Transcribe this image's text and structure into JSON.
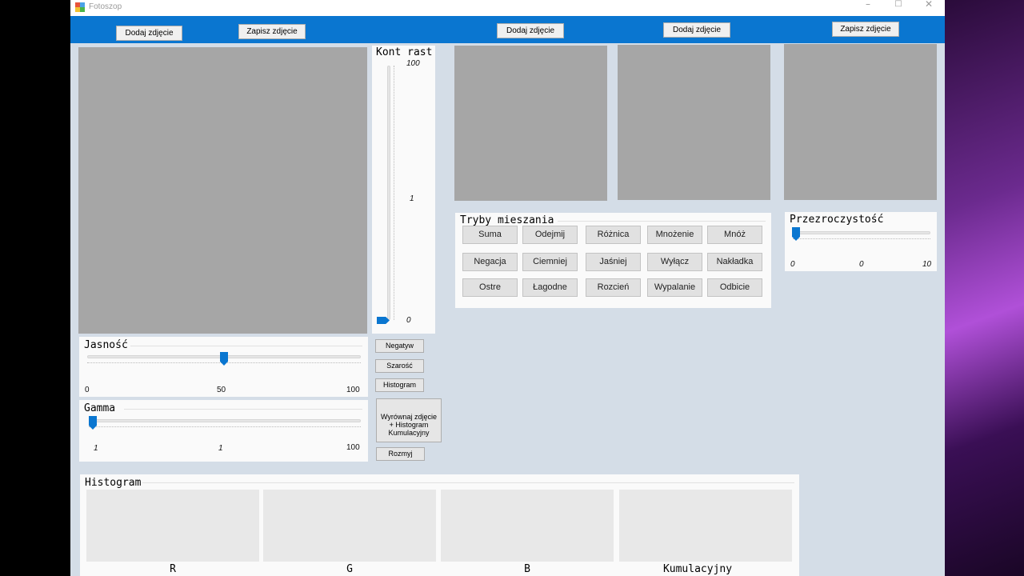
{
  "window": {
    "title": "Fotoszop",
    "controls": {
      "minimize": "–",
      "maximize": "□",
      "close": "✕"
    }
  },
  "toolbar": {
    "left_add": "Dodaj zdjęcie",
    "left_save": "Zapisz zdjęcie",
    "blend_add_1": "Dodaj zdjęcie",
    "blend_add_2": "Dodaj zdjęcie",
    "blend_save": "Zapisz zdjęcie"
  },
  "contrast": {
    "title": "Kont rast",
    "max_label": "100",
    "mid_label": "1",
    "min_label": "0",
    "value": 0
  },
  "brightness": {
    "title": "Jasność",
    "min_label": "0",
    "mid_label": "50",
    "max_label": "100",
    "value": 50
  },
  "gamma": {
    "title": "Gamma",
    "min_label": "1",
    "mid_label": "1",
    "max_label": "100",
    "value": 1
  },
  "actions": {
    "negative": "Negatyw",
    "grayscale": "Szarość",
    "histogram": "Histogram",
    "equalize_line1": "Wyrównaj zdjęcie",
    "equalize_line2": "+ Histogram",
    "equalize_line3": "Kumulacyjny",
    "blur": "Rozmyj"
  },
  "blend_modes": {
    "title": "Tryby mieszania",
    "buttons": [
      "Suma",
      "Odejmij",
      "Różnica",
      "Mnożenie",
      "Mnóż",
      "Negacja",
      "Ciemniej",
      "Jaśniej",
      "Wyłącz",
      "Nakładka",
      "Ostre",
      "Łagodne",
      "Rozcień",
      "Wypalanie",
      "Odbicie"
    ]
  },
  "opacity": {
    "title": "Przezroczystość",
    "min_label": "0",
    "mid_label": "0",
    "max_label": "10",
    "value": 0
  },
  "histogram": {
    "title": "Histogram",
    "labels": [
      "R",
      "G",
      "B",
      "Kumulacyjny"
    ]
  },
  "colors": {
    "accent": "#0a76d0",
    "window_bg": "#d4dde7",
    "image_placeholder": "#a6a6a6",
    "histogram_placeholder": "#e8e8e8"
  }
}
